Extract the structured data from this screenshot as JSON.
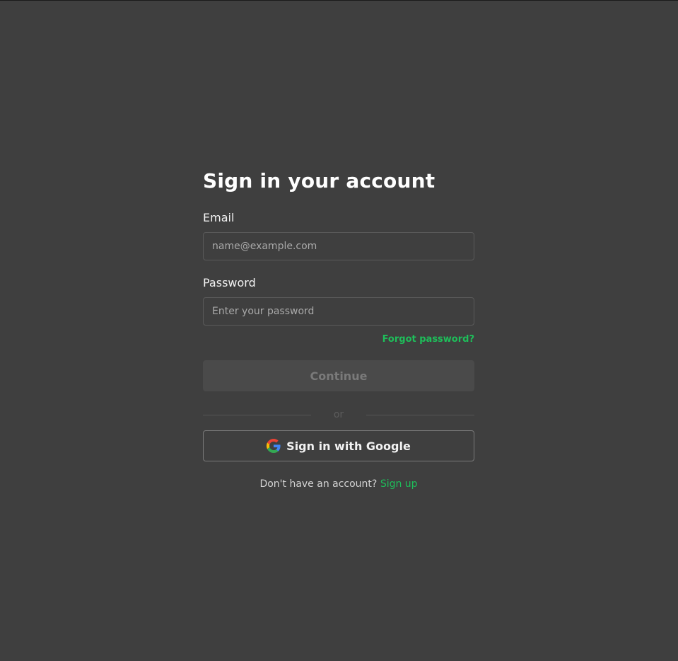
{
  "page": {
    "title": "Sign in your account"
  },
  "form": {
    "email_label": "Email",
    "email_placeholder": "name@example.com",
    "email_value": "",
    "password_label": "Password",
    "password_placeholder": "Enter your password",
    "password_value": "",
    "forgot_label": "Forgot password?",
    "continue_label": "Continue",
    "divider_text": "or",
    "google_label": "Sign in with Google",
    "google_icon": "google-g-icon",
    "footer_text": "Don't have an account? ",
    "signup_label": "Sign up"
  },
  "colors": {
    "background": "#3f3f3f",
    "accent": "#1ebe5a",
    "button_disabled": "#4a4a4a"
  }
}
